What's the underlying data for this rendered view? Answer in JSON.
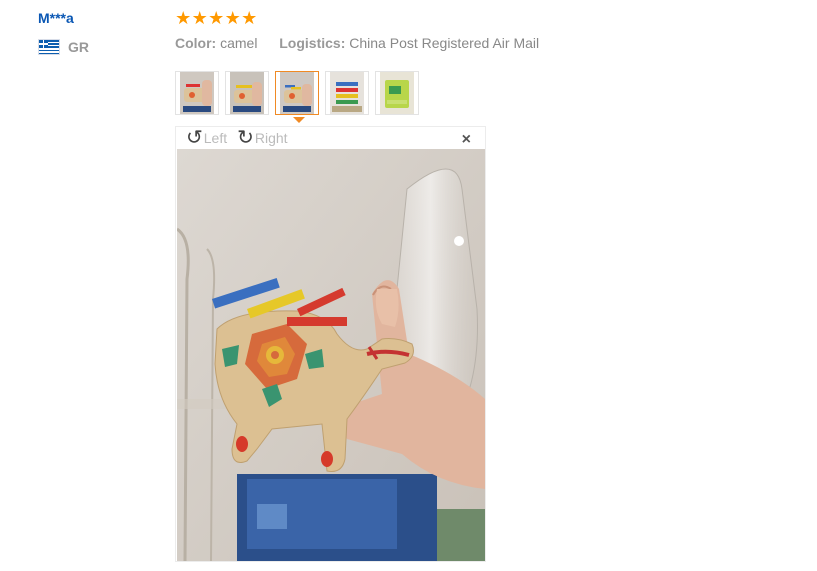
{
  "review": {
    "user_name": "M***a",
    "country_code": "GR",
    "rating": 5,
    "color_label": "Color:",
    "color_value": "camel",
    "logistics_label": "Logistics:",
    "logistics_value": "China Post Registered Air Mail"
  },
  "thumbnails": [
    {
      "name": "thumb-1",
      "active": false
    },
    {
      "name": "thumb-2",
      "active": false
    },
    {
      "name": "thumb-3",
      "active": true
    },
    {
      "name": "thumb-4",
      "active": false
    },
    {
      "name": "thumb-5",
      "active": false
    }
  ],
  "viewer": {
    "rotate_left_label": "Left",
    "rotate_right_label": "Right",
    "close_symbol": "×"
  },
  "icons": {
    "star": "star-icon",
    "rotate_left": "rotate-left-icon",
    "rotate_right": "rotate-right-icon",
    "close": "close-icon",
    "flag": "greece-flag-icon"
  },
  "colors": {
    "user_name": "#0a57b4",
    "star": "#ff9900",
    "active_border": "#f08a24"
  }
}
